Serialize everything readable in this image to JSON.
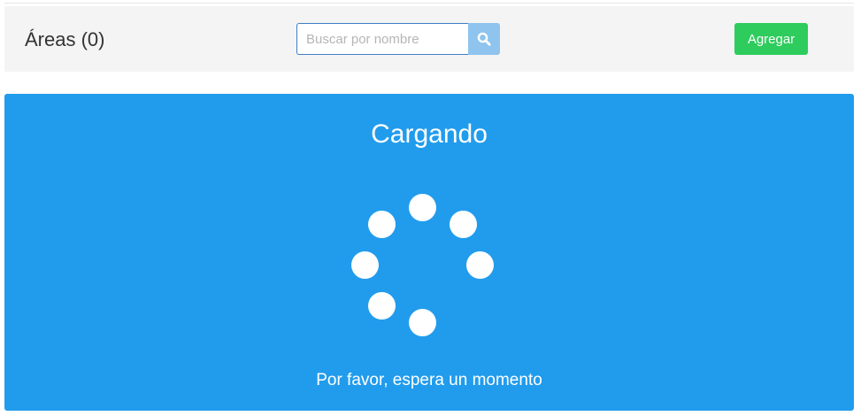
{
  "header": {
    "title": "Áreas (0)",
    "search": {
      "placeholder": "Buscar por nombre",
      "value": "",
      "icon": "search-icon"
    },
    "add_button_label": "Agregar"
  },
  "loading": {
    "title": "Cargando",
    "message": "Por favor, espera un momento",
    "spinner_icon": "loading-spinner-icon"
  },
  "colors": {
    "panel": "#219ced",
    "add_button": "#2ecc5d",
    "search_button": "#8ec4ee",
    "header_bg": "#f4f4f4"
  }
}
